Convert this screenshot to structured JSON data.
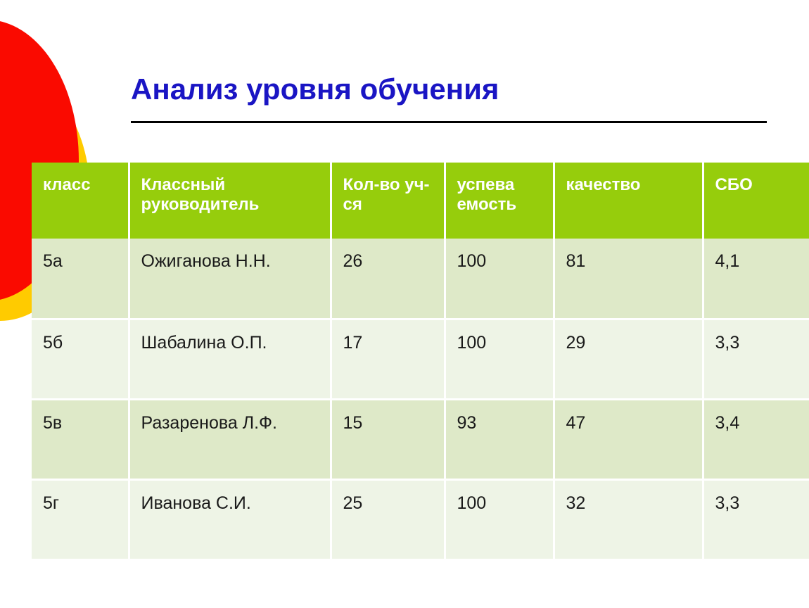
{
  "slide": {
    "title": "Анализ уровня обучения",
    "title_color": "#1a15c4",
    "background_color": "#ffffff",
    "decorations": [
      {
        "name": "red-circle",
        "color": "#fa0a00"
      },
      {
        "name": "yellow-circle",
        "color": "#ffcb00"
      }
    ]
  },
  "table": {
    "header_bg": "#96cd0c",
    "header_text_color": "#ffffff",
    "row_even_bg": "#dee9c8",
    "row_odd_bg": "#eef4e6",
    "columns": [
      {
        "key": "class",
        "label": "класс"
      },
      {
        "key": "teacher",
        "label": "Классный руководитель"
      },
      {
        "key": "count",
        "label": "Кол-во уч-ся"
      },
      {
        "key": "progress",
        "label": "успева емость"
      },
      {
        "key": "quality",
        "label": "качество"
      },
      {
        "key": "sbo",
        "label": "СБО"
      }
    ],
    "rows": [
      {
        "class": "5а",
        "teacher": "Ожиганова Н.Н.",
        "count": "26",
        "progress": "100",
        "quality": "81",
        "sbo": "4,1"
      },
      {
        "class": "5б",
        "teacher": "Шабалина О.П.",
        "count": "17",
        "progress": "100",
        "quality": "29",
        "sbo": "3,3"
      },
      {
        "class": "5в",
        "teacher": "Разаренова Л.Ф.",
        "count": "15",
        "progress": "93",
        "quality": "47",
        "sbo": "3,4"
      },
      {
        "class": "5г",
        "teacher": "Иванова С.И.",
        "count": "25",
        "progress": "100",
        "quality": "32",
        "sbo": "3,3"
      }
    ]
  }
}
